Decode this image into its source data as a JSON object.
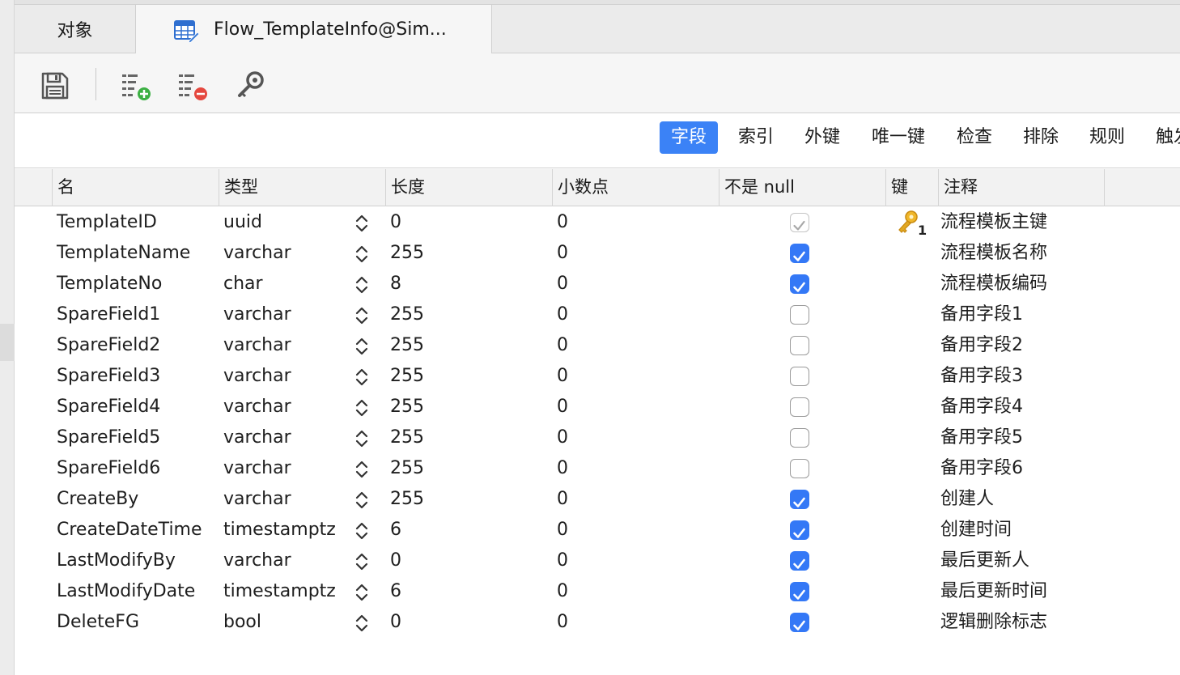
{
  "tabs": {
    "objects_label": "对象",
    "active_label": "Flow_TemplateInfo@Sim..."
  },
  "toolbar": {
    "save_icon": "save-icon",
    "add_field_icon": "add-field-icon",
    "delete_field_icon": "delete-field-icon",
    "primary_key_icon": "key-icon"
  },
  "subtabs": [
    "字段",
    "索引",
    "外键",
    "唯一键",
    "检查",
    "排除",
    "规则",
    "触发"
  ],
  "columns": [
    "名",
    "类型",
    "长度",
    "小数点",
    "不是 null",
    "键",
    "注释"
  ],
  "rows": [
    {
      "name": "TemplateID",
      "type": "uuid",
      "length": "0",
      "decimals": "0",
      "not_null": "checked-disabled",
      "key": "1",
      "comment": "流程模板主键"
    },
    {
      "name": "TemplateName",
      "type": "varchar",
      "length": "255",
      "decimals": "0",
      "not_null": "checked",
      "key": "",
      "comment": "流程模板名称"
    },
    {
      "name": "TemplateNo",
      "type": "char",
      "length": "8",
      "decimals": "0",
      "not_null": "checked",
      "key": "",
      "comment": "流程模板编码"
    },
    {
      "name": "SpareField1",
      "type": "varchar",
      "length": "255",
      "decimals": "0",
      "not_null": "unchecked",
      "key": "",
      "comment": "备用字段1"
    },
    {
      "name": "SpareField2",
      "type": "varchar",
      "length": "255",
      "decimals": "0",
      "not_null": "unchecked",
      "key": "",
      "comment": "备用字段2"
    },
    {
      "name": "SpareField3",
      "type": "varchar",
      "length": "255",
      "decimals": "0",
      "not_null": "unchecked",
      "key": "",
      "comment": "备用字段3"
    },
    {
      "name": "SpareField4",
      "type": "varchar",
      "length": "255",
      "decimals": "0",
      "not_null": "unchecked",
      "key": "",
      "comment": "备用字段4"
    },
    {
      "name": "SpareField5",
      "type": "varchar",
      "length": "255",
      "decimals": "0",
      "not_null": "unchecked",
      "key": "",
      "comment": "备用字段5"
    },
    {
      "name": "SpareField6",
      "type": "varchar",
      "length": "255",
      "decimals": "0",
      "not_null": "unchecked",
      "key": "",
      "comment": "备用字段6"
    },
    {
      "name": "CreateBy",
      "type": "varchar",
      "length": "255",
      "decimals": "0",
      "not_null": "checked",
      "key": "",
      "comment": "创建人"
    },
    {
      "name": "CreateDateTime",
      "type": "timestamptz",
      "length": "6",
      "decimals": "0",
      "not_null": "checked",
      "key": "",
      "comment": "创建时间"
    },
    {
      "name": "LastModifyBy",
      "type": "varchar",
      "length": "0",
      "decimals": "0",
      "not_null": "checked",
      "key": "",
      "comment": "最后更新人"
    },
    {
      "name": "LastModifyDate",
      "type": "timestamptz",
      "length": "6",
      "decimals": "0",
      "not_null": "checked",
      "key": "",
      "comment": "最后更新时间"
    },
    {
      "name": "DeleteFG",
      "type": "bool",
      "length": "0",
      "decimals": "0",
      "not_null": "checked",
      "key": "",
      "comment": "逻辑删除标志"
    }
  ],
  "colors": {
    "accent": "#3b82f6",
    "checkbox_on": "#3478f6",
    "key_gold": "#e2a822"
  }
}
